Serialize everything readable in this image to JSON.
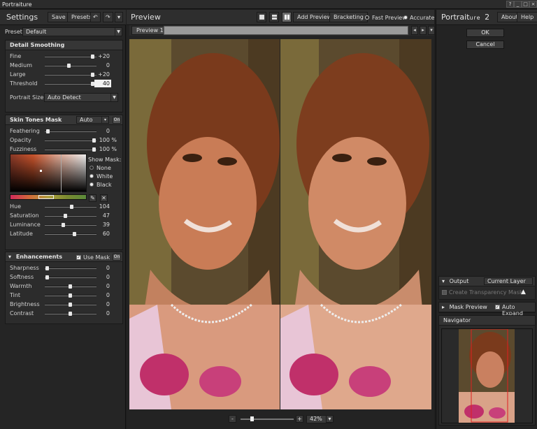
{
  "window": {
    "title": "Portraiture",
    "controls": [
      "?",
      "_",
      "□",
      "×"
    ]
  },
  "left": {
    "title": "Settings",
    "buttons": {
      "save": "Save",
      "presets": "Presets",
      "undo": "↶",
      "redo": "↷",
      "menu": "▾"
    },
    "preset": {
      "label": "Preset",
      "value": "Default"
    },
    "detail": {
      "title": "Detail Smoothing",
      "sliders": [
        {
          "name": "Fine",
          "value": "+20",
          "level": 0.92
        },
        {
          "name": "Medium",
          "value": "0",
          "level": 0.45
        },
        {
          "name": "Large",
          "value": "+20",
          "level": 0.92
        },
        {
          "name": "Threshold",
          "value": "40",
          "level": 0.92
        }
      ],
      "portrait_size_label": "Portrait Size",
      "portrait_size_value": "Auto Detect"
    },
    "skin": {
      "title": "Skin Tones Mask",
      "mode": "Auto",
      "on": "On",
      "sliders": [
        {
          "name": "Feathering",
          "value": "0",
          "unit": "",
          "level": 0.03
        },
        {
          "name": "Opacity",
          "value": "100",
          "unit": "%",
          "level": 0.95
        },
        {
          "name": "Fuzziness",
          "value": "100",
          "unit": "%",
          "level": 0.95
        }
      ],
      "show_mask_label": "Show Mask:",
      "show_mask_options": [
        "None",
        "White",
        "Black"
      ],
      "hsl": [
        {
          "name": "Hue",
          "value": "104",
          "level": 0.5
        },
        {
          "name": "Saturation",
          "value": "47",
          "level": 0.38
        },
        {
          "name": "Luminance",
          "value": "39",
          "level": 0.33
        },
        {
          "name": "Latitude",
          "value": "60",
          "level": 0.55
        }
      ]
    },
    "enh": {
      "title": "Enhancements",
      "use_mask": "Use Mask",
      "on": "On",
      "sliders": [
        {
          "name": "Sharpness",
          "value": "0",
          "level": 0.02
        },
        {
          "name": "Softness",
          "value": "0",
          "level": 0.02
        },
        {
          "name": "Warmth",
          "value": "0",
          "level": 0.47
        },
        {
          "name": "Tint",
          "value": "0",
          "level": 0.47
        },
        {
          "name": "Brightness",
          "value": "0",
          "level": 0.47
        },
        {
          "name": "Contrast",
          "value": "0",
          "level": 0.47
        }
      ]
    }
  },
  "center": {
    "title": "Preview",
    "add_preview": "Add Preview",
    "bracketing": "Bracketing",
    "fast_preview": "Fast Preview",
    "accurate": "Accurate",
    "tab": "Preview 1",
    "zoom": "42%",
    "zoom_minus": "-",
    "zoom_plus": "+",
    "zoom_level": 0.2
  },
  "right": {
    "logo_a": "Portrait",
    "logo_b": "ure",
    "logo_c": "2",
    "about": "About",
    "help": "Help",
    "ok": "OK",
    "cancel": "Cancel",
    "output": {
      "label": "Output",
      "value": "Current Layer",
      "transparency": "Create Transparency Mask"
    },
    "mask_preview": {
      "label": "Mask Preview",
      "auto_expand": "Auto Expand"
    },
    "navigator": "Navigator"
  }
}
